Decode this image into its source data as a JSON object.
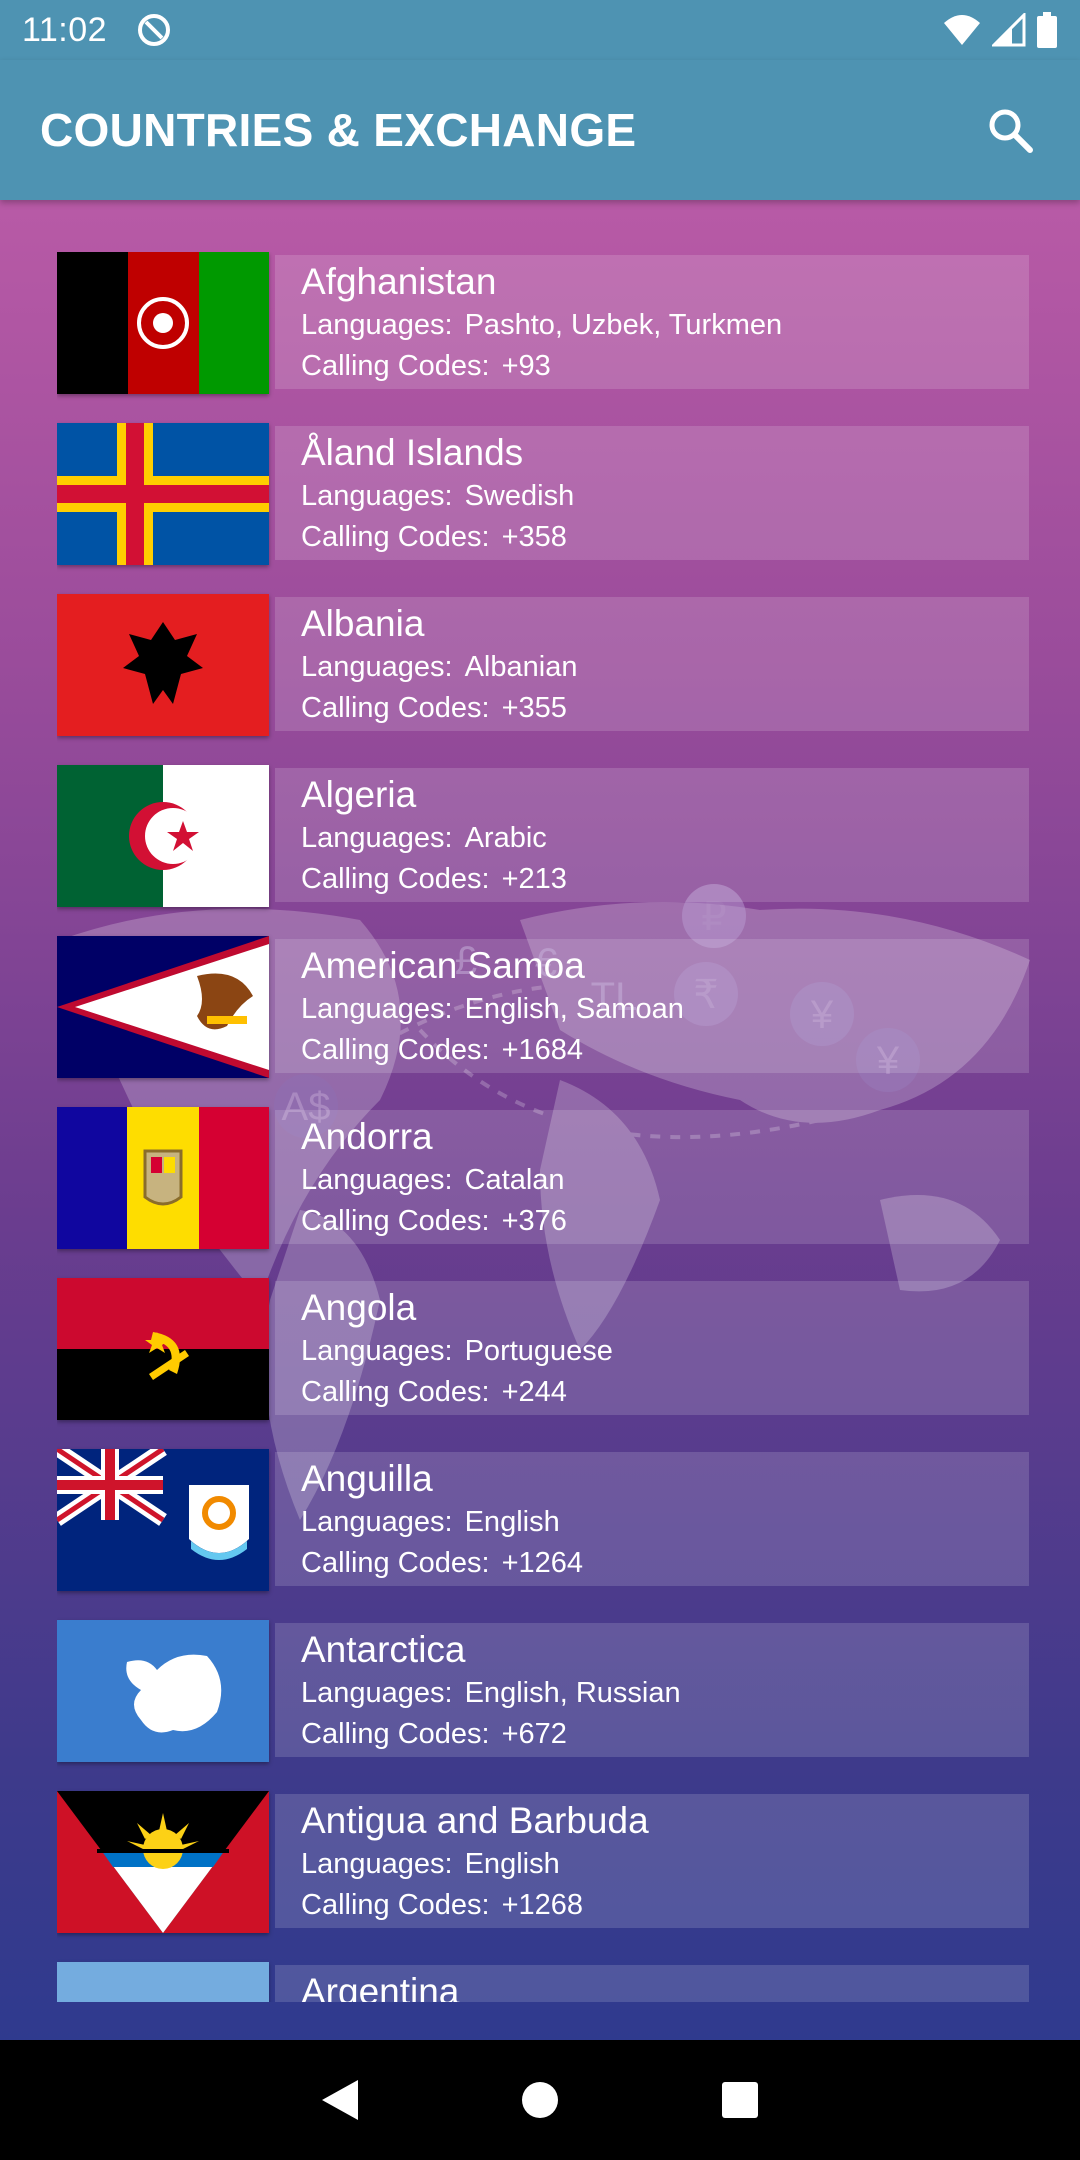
{
  "status_bar": {
    "time": "11:02"
  },
  "app_bar": {
    "title": "COUNTRIES & EXCHANGE"
  },
  "labels": {
    "languages": "Languages:",
    "calling_codes": "Calling Codes:"
  },
  "countries": [
    {
      "name": "Afghanistan",
      "languages": "Pashto, Uzbek, Turkmen",
      "calling_codes": "+93"
    },
    {
      "name": "Åland Islands",
      "languages": "Swedish",
      "calling_codes": "+358"
    },
    {
      "name": "Albania",
      "languages": "Albanian",
      "calling_codes": "+355"
    },
    {
      "name": "Algeria",
      "languages": "Arabic",
      "calling_codes": "+213"
    },
    {
      "name": "American Samoa",
      "languages": "English, Samoan",
      "calling_codes": "+1684"
    },
    {
      "name": "Andorra",
      "languages": "Catalan",
      "calling_codes": "+376"
    },
    {
      "name": "Angola",
      "languages": "Portuguese",
      "calling_codes": "+244"
    },
    {
      "name": "Anguilla",
      "languages": "English",
      "calling_codes": "+1264"
    },
    {
      "name": "Antarctica",
      "languages": "English, Russian",
      "calling_codes": "+672"
    },
    {
      "name": "Antigua and Barbuda",
      "languages": "English",
      "calling_codes": "+1268"
    },
    {
      "name": "Argentina",
      "languages": "",
      "calling_codes": ""
    }
  ],
  "background_symbols": [
    "₽",
    "₹",
    "¥",
    "¥",
    "TL",
    "A$",
    "€",
    "£"
  ],
  "colors": {
    "app_bar": "#4e93b2",
    "gradient_top": "#b85aa6",
    "gradient_bottom": "#2f3a8e"
  },
  "icons": {
    "search": "search-icon",
    "back": "back-icon",
    "home": "home-icon",
    "recents": "recents-icon"
  }
}
